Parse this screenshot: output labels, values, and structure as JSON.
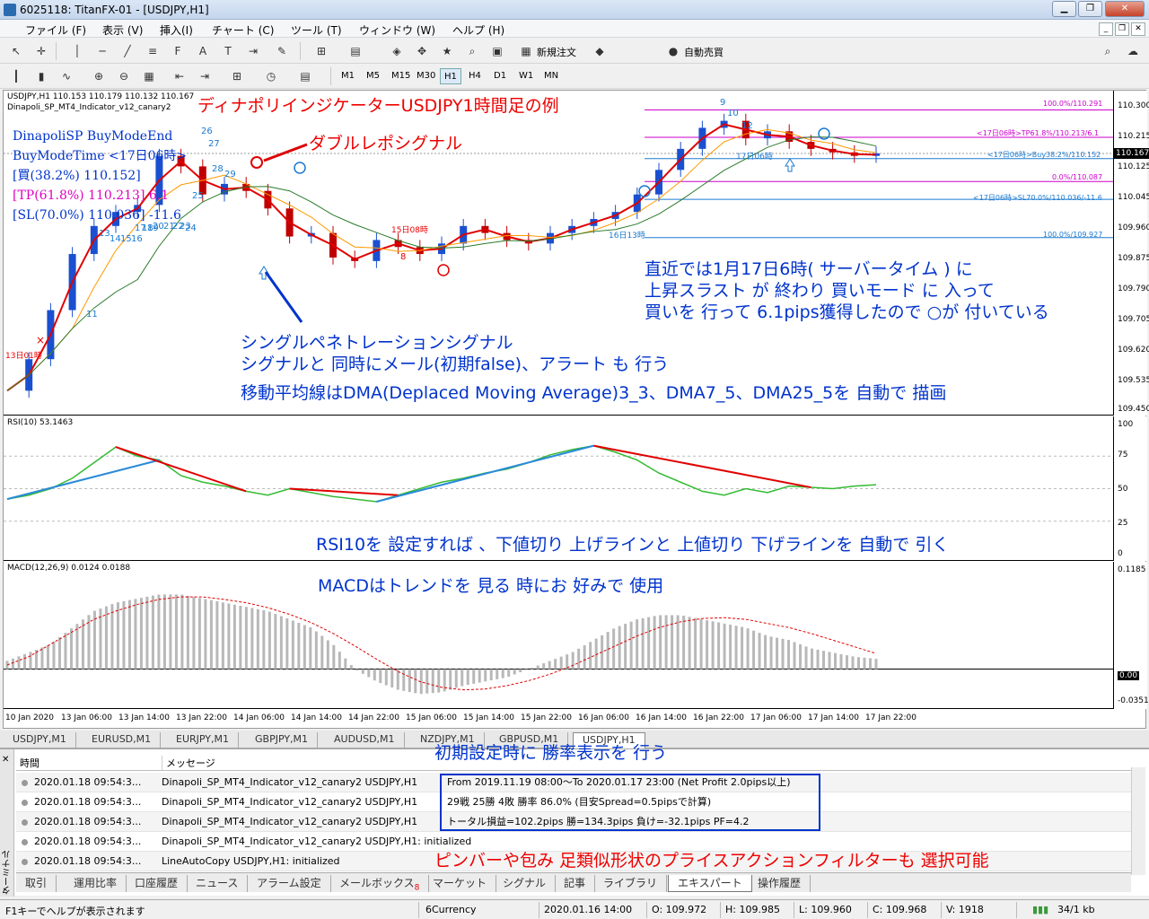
{
  "window": {
    "title": "6025118: TitanFX-01 - [USDJPY,H1]",
    "minimize": "▁",
    "restore": "❐",
    "close": "✕"
  },
  "menu": [
    "ファイル (F)",
    "表示 (V)",
    "挿入(I)",
    "チャート (C)",
    "ツール (T)",
    "ウィンドウ (W)",
    "ヘルプ (H)"
  ],
  "toolbar": {
    "new_order": "新規注文",
    "auto_trade": "自動売買"
  },
  "timeframes": [
    "M1",
    "M5",
    "M15",
    "M30",
    "H1",
    "H4",
    "D1",
    "W1",
    "MN"
  ],
  "active_timeframe": "H1",
  "main_chart": {
    "info": "USDJPY,H1  110.153 110.179 110.132 110.167",
    "indicator_name": "Dinapoli_SP_MT4_Indicator_v12_canary2",
    "price_label": "110.167",
    "overlay_lines": [
      "DinapoliSP BuyModeEnd",
      "BuyModeTime <17日06時>",
      "[買(38.2%) 110.152]",
      "[TP(61.8%) 110.213] 6.1",
      "[SL(70.0%) 110.036] -11.6"
    ],
    "fib_labels": [
      "100.0%/110.291",
      "<17日06時>TP61.8%/110.213/6.1",
      "<17日06時>Buy38.2%/110.152",
      "0.0%/110.087",
      "<17日06時>SL70.0%/110.036/-11.6",
      "100.0%/109.927"
    ],
    "price_scale": [
      "110.300",
      "110.215",
      "110.125",
      "110.045",
      "109.960",
      "109.875",
      "109.790",
      "109.705",
      "109.620",
      "109.535",
      "109.450"
    ],
    "counts": [
      "26",
      "27",
      "28",
      "29",
      "25",
      "24",
      "13",
      "14",
      "15",
      "16",
      "17",
      "18",
      "19",
      "20",
      "21",
      "22",
      "23",
      "11",
      "8",
      "9",
      "12",
      "10"
    ],
    "chart_labels": [
      "13日01時",
      "15日08時",
      "16日13時",
      "17日06時"
    ]
  },
  "annotations": {
    "title": "ディナポリインジケーターUSDJPY1時間足の例",
    "double_repo": "ダブルレポシグナル",
    "recent1": "直近では1月17日6時( サーバータイム ) に",
    "recent2": "上昇スラスト が 終わり 買いモード に 入って",
    "recent3": "買いを 行って 6.1pips獲得したので ○が 付いている",
    "single1": "シングルペネトレーションシグナル",
    "single2": "シグナルと 同時にメール(初期false)、アラート も 行う",
    "dma": "移動平均線はDMA(Deplaced Moving Average)3_3、DMA7_5、DMA25_5を 自動で 描画",
    "rsi": "RSI10を 設定すれば 、下値切り 上げラインと 上値切り 下げラインを 自動で 引く",
    "macd": "MACDはトレンドを 見る 時にお 好みで 使用",
    "winrate": "初期設定時に 勝率表示を 行う",
    "pinbar": "ピンバーや包み 足類似形状のプライスアクションフィルターも 選択可能"
  },
  "rsi": {
    "title": "RSI(10) 53.1463",
    "scale": [
      "100",
      "75",
      "50",
      "25",
      "0"
    ]
  },
  "macd": {
    "title": "MACD(12,26,9) 0.0124 0.0188",
    "scale_top": "0.1185",
    "scale_zero": "0.00",
    "scale_bottom": "-0.0351"
  },
  "time_axis": [
    "10 Jan 2020",
    "13 Jan 06:00",
    "13 Jan 14:00",
    "13 Jan 22:00",
    "14 Jan 06:00",
    "14 Jan 14:00",
    "14 Jan 22:00",
    "15 Jan 06:00",
    "15 Jan 14:00",
    "15 Jan 22:00",
    "16 Jan 06:00",
    "16 Jan 14:00",
    "16 Jan 22:00",
    "17 Jan 06:00",
    "17 Jan 14:00",
    "17 Jan 22:00"
  ],
  "symbol_tabs": [
    "USDJPY,M1",
    "EURUSD,M1",
    "EURJPY,M1",
    "GBPJPY,M1",
    "AUDUSD,M1",
    "NZDJPY,M1",
    "GBPUSD,M1",
    "USDJPY,H1"
  ],
  "active_symbol_tab": "USDJPY,H1",
  "terminal": {
    "col_time": "時間",
    "col_message": "メッセージ",
    "side_label": "ターミナル",
    "rows": [
      {
        "time": "2020.01.18 09:54:3...",
        "msg": "Dinapoli_SP_MT4_Indicator_v12_canary2 USDJPY,H1",
        "extra": "From 2019.11.19 08:00～To 2020.01.17 23:00 (Net Profit 2.0pips以上)"
      },
      {
        "time": "2020.01.18 09:54:3...",
        "msg": "Dinapoli_SP_MT4_Indicator_v12_canary2 USDJPY,H1",
        "extra": "29戦 25勝 4敗 勝率 86.0% (目安Spread=0.5pipsで計算)"
      },
      {
        "time": "2020.01.18 09:54:3...",
        "msg": "Dinapoli_SP_MT4_Indicator_v12_canary2 USDJPY,H1",
        "extra": "トータル損益=102.2pips 勝=134.3pips 負け=-32.1pips PF=4.2"
      },
      {
        "time": "2020.01.18 09:54:3...",
        "msg": "Dinapoli_SP_MT4_Indicator_v12_canary2 USDJPY,H1: initialized",
        "extra": ""
      },
      {
        "time": "2020.01.18 09:54:3...",
        "msg": "LineAutoCopy USDJPY,H1: initialized",
        "extra": ""
      }
    ],
    "tabs": [
      "取引",
      "運用比率",
      "口座履歴",
      "ニュース",
      "アラーム設定",
      "メールボックス",
      "マーケット",
      "シグナル",
      "記事",
      "ライブラリ",
      "エキスパート",
      "操作履歴"
    ],
    "mailbox_count": "8",
    "active_tab": "エキスパート"
  },
  "status": {
    "help": "F1キーでヘルプが表示されます",
    "profile": "6Currency",
    "datetime": "2020.01.16 14:00",
    "open": "O: 109.972",
    "high": "H: 109.985",
    "low": "L: 109.960",
    "close": "C: 109.968",
    "volume": "V: 1918",
    "traffic": "34/1 kb"
  },
  "chart_data": {
    "type": "line",
    "x": [
      0,
      4,
      8,
      12,
      16,
      20,
      24,
      28,
      32,
      36,
      40,
      44,
      48,
      52,
      56,
      60,
      64,
      68,
      72,
      76,
      80,
      84,
      88,
      92,
      96,
      100,
      104,
      108,
      112,
      116,
      120,
      124,
      128,
      132,
      136,
      140,
      144,
      148,
      152,
      156,
      160
    ],
    "series": [
      {
        "values": [
          109.49,
          109.58,
          109.72,
          109.88,
          109.96,
          110.0,
          110.02,
          110.16,
          110.13,
          110.05,
          110.08,
          110.06,
          110.01,
          109.93,
          109.94,
          109.87,
          109.86,
          109.92,
          109.9,
          109.88,
          109.91,
          109.96,
          109.94,
          109.92,
          109.91,
          109.94,
          109.96,
          109.98,
          110.0,
          110.05,
          110.12,
          110.18,
          110.24,
          110.26,
          110.21,
          110.23,
          110.2,
          110.18,
          110.17,
          110.16,
          110.167
        ]
      }
    ],
    "ylim": [
      109.45,
      110.3
    ],
    "rsi_values": [
      42,
      45,
      50,
      58,
      70,
      82,
      75,
      72,
      60,
      55,
      52,
      48,
      45,
      50,
      47,
      44,
      42,
      40,
      45,
      50,
      55,
      58,
      62,
      65,
      70,
      76,
      80,
      83,
      78,
      72,
      62,
      55,
      48,
      45,
      50,
      47,
      52,
      51,
      50,
      52,
      53
    ],
    "rsi_ylim": [
      0,
      100
    ],
    "macd_hist": [
      0.01,
      0.02,
      0.03,
      0.05,
      0.07,
      0.08,
      0.085,
      0.09,
      0.09,
      0.085,
      0.08,
      0.075,
      0.07,
      0.06,
      0.05,
      0.03,
      0.0,
      -0.015,
      -0.025,
      -0.03,
      -0.028,
      -0.02,
      -0.015,
      -0.01,
      0.0,
      0.01,
      0.02,
      0.035,
      0.05,
      0.06,
      0.065,
      0.065,
      0.06,
      0.055,
      0.05,
      0.04,
      0.035,
      0.025,
      0.02,
      0.015,
      0.0124
    ],
    "macd_signal": [
      0.005,
      0.015,
      0.03,
      0.045,
      0.06,
      0.07,
      0.078,
      0.084,
      0.087,
      0.087,
      0.084,
      0.08,
      0.074,
      0.066,
      0.056,
      0.043,
      0.028,
      0.012,
      -0.003,
      -0.015,
      -0.022,
      -0.025,
      -0.024,
      -0.02,
      -0.014,
      -0.006,
      0.004,
      0.016,
      0.028,
      0.04,
      0.05,
      0.057,
      0.061,
      0.062,
      0.06,
      0.055,
      0.05,
      0.043,
      0.035,
      0.027,
      0.0188
    ],
    "macd_ylim": [
      -0.0351,
      0.1185
    ]
  }
}
